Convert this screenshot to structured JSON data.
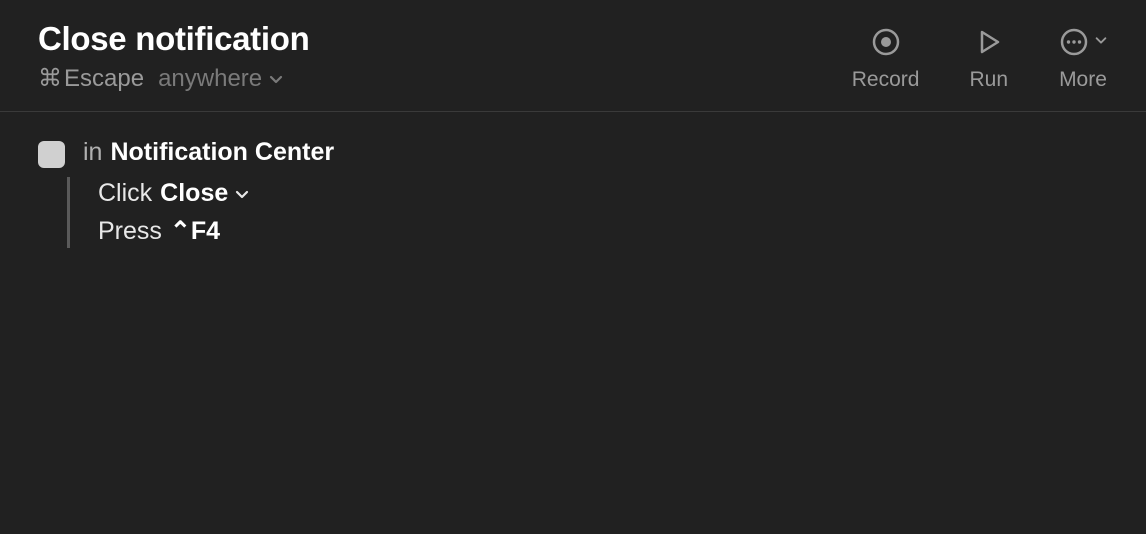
{
  "header": {
    "title": "Close notification",
    "shortcut": {
      "modifier_symbol": "⌘",
      "key": "Escape"
    },
    "scope": {
      "label": "anywhere"
    }
  },
  "toolbar": {
    "record": {
      "label": "Record"
    },
    "run": {
      "label": "Run"
    },
    "more": {
      "label": "More"
    }
  },
  "block": {
    "in_label": "in",
    "app_name": "Notification Center",
    "steps": [
      {
        "verb": "Click",
        "target": "Close",
        "has_dropdown": true
      },
      {
        "verb": "Press",
        "modifier_symbol": "⌃",
        "key": "F4"
      }
    ]
  }
}
